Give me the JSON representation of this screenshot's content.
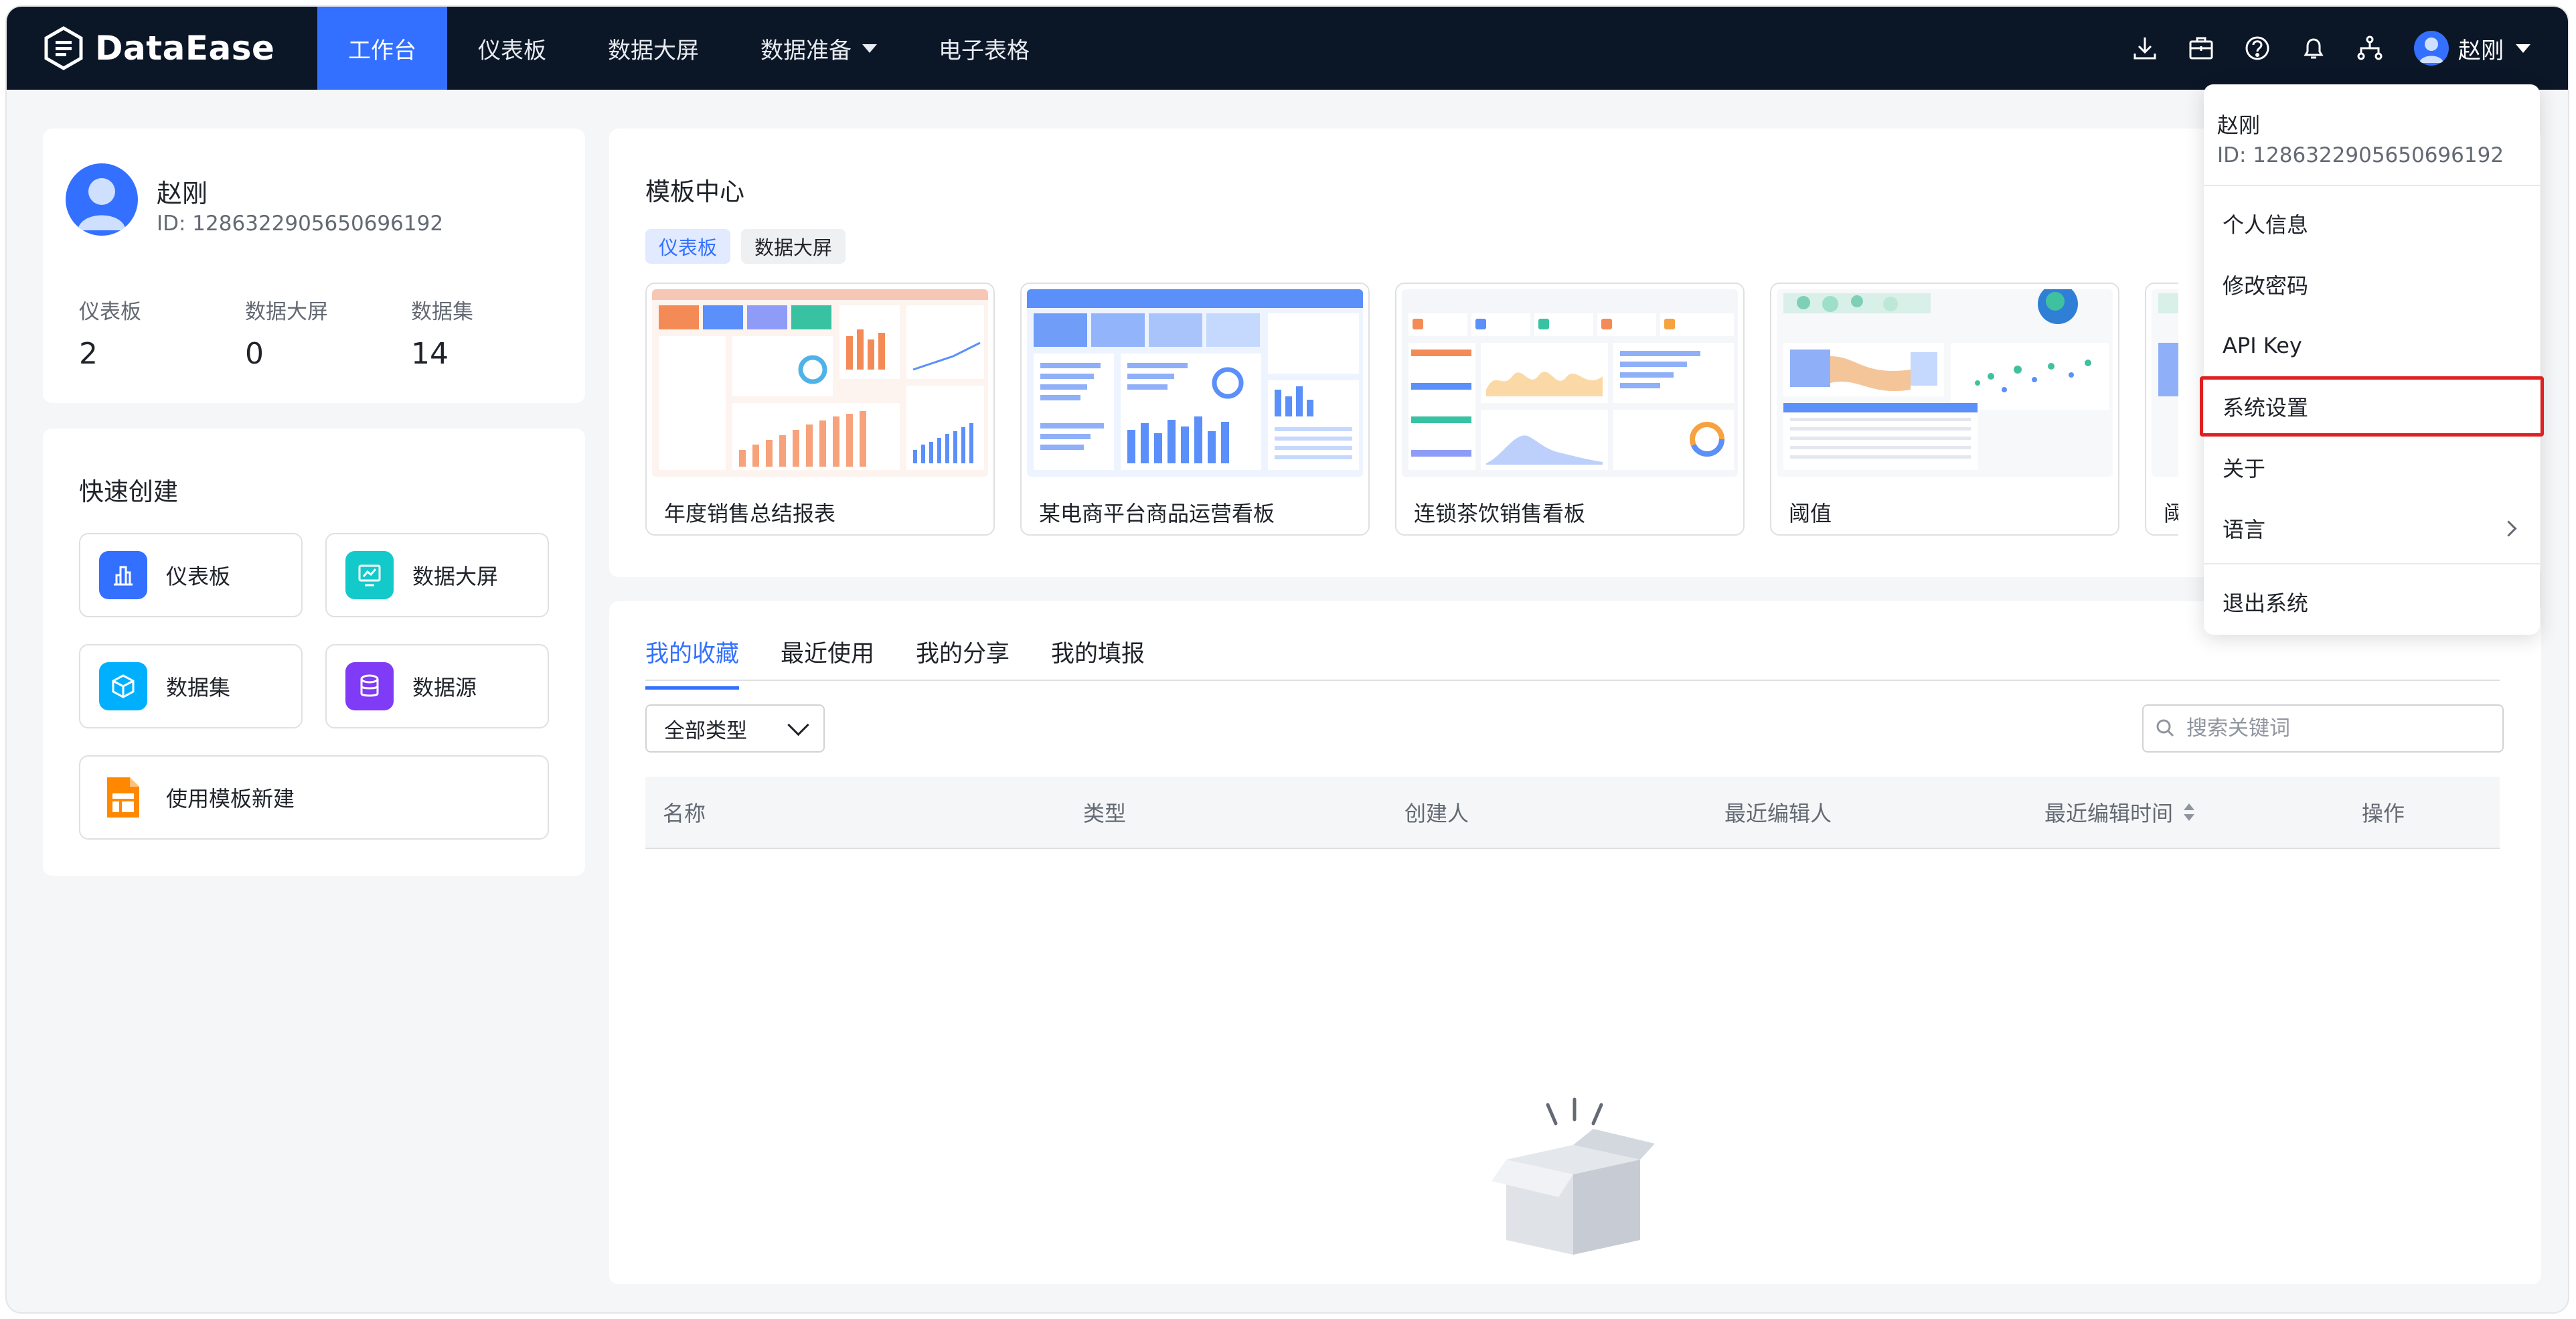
{
  "app": {
    "logo_text": "DataEase"
  },
  "nav": [
    {
      "label": "工作台",
      "active": true
    },
    {
      "label": "仪表板"
    },
    {
      "label": "数据大屏"
    },
    {
      "label": "数据准备",
      "has_dropdown": true
    },
    {
      "label": "电子表格"
    }
  ],
  "topbar_icons": [
    "download-icon",
    "toolbox-icon",
    "help-icon",
    "bell-icon",
    "org-tree-icon"
  ],
  "user": {
    "name": "赵刚",
    "id": "ID: 1286322905650696192"
  },
  "stats": [
    {
      "label": "仪表板",
      "value": "2"
    },
    {
      "label": "数据大屏",
      "value": "0"
    },
    {
      "label": "数据集",
      "value": "14"
    }
  ],
  "quick_create": {
    "title": "快速创建",
    "items": [
      {
        "label": "仪表板",
        "icon": "bar-chart-icon",
        "color": "#3370ff"
      },
      {
        "label": "数据大屏",
        "icon": "screen-icon",
        "color": "#14c9c9"
      },
      {
        "label": "数据集",
        "icon": "cube-icon",
        "color": "#00b0ff"
      },
      {
        "label": "数据源",
        "icon": "database-icon",
        "color": "#7f3bf5"
      },
      {
        "label": "使用模板新建",
        "icon": "template-icon",
        "color": "#ff8800"
      }
    ]
  },
  "templates": {
    "title": "模板中心",
    "tabs": [
      {
        "label": "仪表板",
        "active": true
      },
      {
        "label": "数据大屏"
      }
    ],
    "items": [
      {
        "name": "年度销售总结报表"
      },
      {
        "name": "某电商平台商品运营看板"
      },
      {
        "name": "连锁茶饮销售看板"
      },
      {
        "name": "阈值"
      },
      {
        "name": "阈值"
      }
    ]
  },
  "list": {
    "tabs": [
      {
        "label": "我的收藏",
        "active": true
      },
      {
        "label": "最近使用"
      },
      {
        "label": "我的分享"
      },
      {
        "label": "我的填报"
      }
    ],
    "type_filter": "全部类型",
    "search_placeholder": "搜索关键词",
    "columns": [
      "名称",
      "类型",
      "创建人",
      "最近编辑人",
      "最近编辑时间",
      "操作"
    ]
  },
  "user_menu": {
    "name": "赵刚",
    "id": "ID: 1286322905650696192",
    "items": [
      {
        "label": "个人信息"
      },
      {
        "label": "修改密码"
      },
      {
        "label": "API Key"
      },
      {
        "label": "系统设置",
        "highlighted": true
      },
      {
        "label": "关于"
      },
      {
        "label": "语言",
        "has_submenu": true
      }
    ],
    "logout": "退出系统"
  },
  "colors": {
    "topbar": "#0b1627",
    "accent": "#3370ff",
    "highlight_border": "#e02020"
  }
}
